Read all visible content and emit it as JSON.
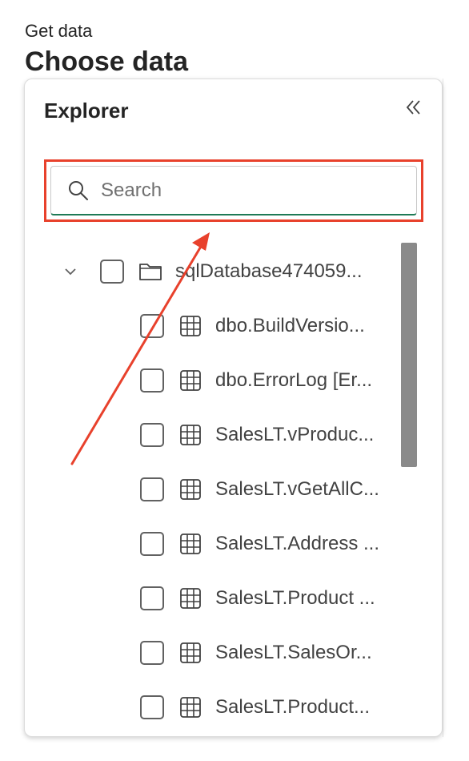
{
  "header": {
    "eyebrow": "Get data",
    "title": "Choose data"
  },
  "explorer": {
    "title": "Explorer",
    "collapse_icon": "double-chevron-left-icon",
    "search": {
      "placeholder": "Search",
      "value": ""
    },
    "root": {
      "label": "sqlDatabase474059...",
      "expanded": true,
      "checked": false,
      "icon": "folder-icon"
    },
    "items": [
      {
        "label": "dbo.BuildVersio...",
        "checked": false,
        "icon": "table-icon"
      },
      {
        "label": "dbo.ErrorLog [Er...",
        "checked": false,
        "icon": "table-icon"
      },
      {
        "label": "SalesLT.vProduc...",
        "checked": false,
        "icon": "table-icon"
      },
      {
        "label": "SalesLT.vGetAllC...",
        "checked": false,
        "icon": "table-icon"
      },
      {
        "label": "SalesLT.Address ...",
        "checked": false,
        "icon": "table-icon"
      },
      {
        "label": "SalesLT.Product ...",
        "checked": false,
        "icon": "table-icon"
      },
      {
        "label": "SalesLT.SalesOr...",
        "checked": false,
        "icon": "table-icon"
      },
      {
        "label": "SalesLT.Product...",
        "checked": false,
        "icon": "table-icon"
      }
    ]
  },
  "annotation": {
    "highlight_color": "#e8412c",
    "arrow_color": "#e8412c"
  }
}
